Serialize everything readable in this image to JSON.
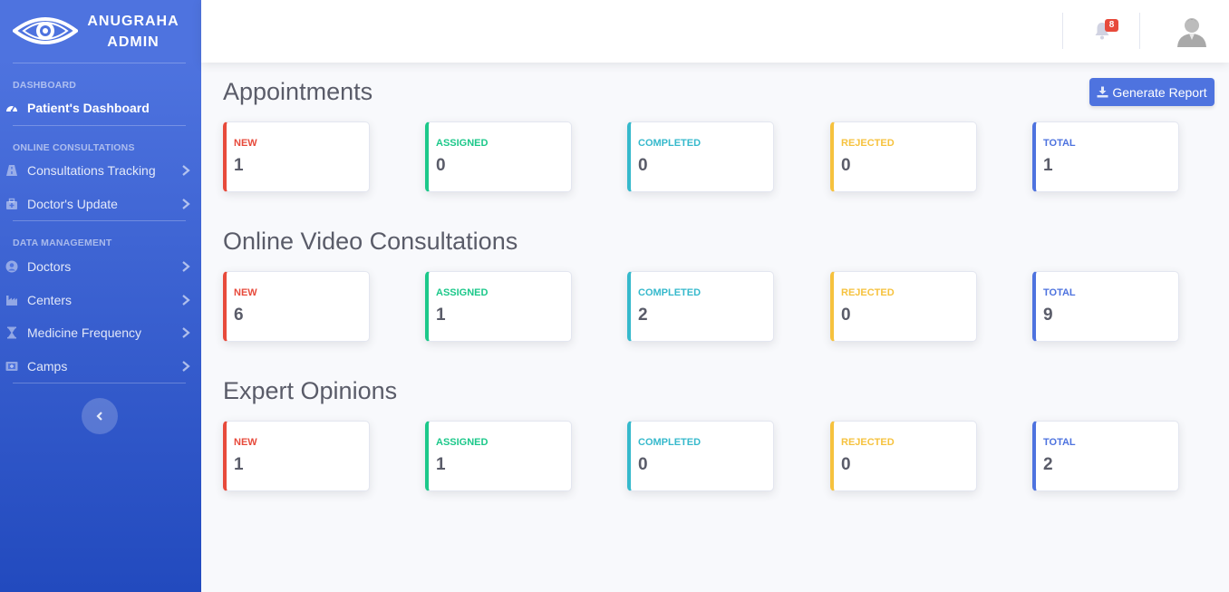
{
  "brand": {
    "line1": "ANUGRAHA",
    "line2": "ADMIN"
  },
  "sidebar": {
    "dashboard_heading": "DASHBOARD",
    "dashboard_item": "Patient's Dashboard",
    "online_heading": "ONLINE CONSULTATIONS",
    "online_items": [
      {
        "label": "Consultations Tracking",
        "icon": "road-icon"
      },
      {
        "label": "Doctor's Update",
        "icon": "briefcase-medical-icon"
      }
    ],
    "data_heading": "DATA MANAGEMENT",
    "data_items": [
      {
        "label": "Doctors",
        "icon": "user-circle-icon"
      },
      {
        "label": "Centers",
        "icon": "industry-icon"
      },
      {
        "label": "Medicine Frequency",
        "icon": "hourglass-icon"
      },
      {
        "label": "Camps",
        "icon": "clinic-icon"
      }
    ]
  },
  "topbar": {
    "notification_count": "8"
  },
  "actions": {
    "generate_report": "Generate Report"
  },
  "colors": {
    "new": "#e74a3b",
    "assigned": "#1cc88a",
    "completed": "#36b9cc",
    "rejected": "#f6c23e",
    "total": "#4e73df"
  },
  "sections": [
    {
      "title": "Appointments",
      "cards": [
        {
          "label": "NEW",
          "value": "1"
        },
        {
          "label": "ASSIGNED",
          "value": "0"
        },
        {
          "label": "COMPLETED",
          "value": "0"
        },
        {
          "label": "REJECTED",
          "value": "0"
        },
        {
          "label": "TOTAL",
          "value": "1"
        }
      ]
    },
    {
      "title": "Online Video Consultations",
      "cards": [
        {
          "label": "NEW",
          "value": "6"
        },
        {
          "label": "ASSIGNED",
          "value": "1"
        },
        {
          "label": "COMPLETED",
          "value": "2"
        },
        {
          "label": "REJECTED",
          "value": "0"
        },
        {
          "label": "TOTAL",
          "value": "9"
        }
      ]
    },
    {
      "title": "Expert Opinions",
      "cards": [
        {
          "label": "NEW",
          "value": "1"
        },
        {
          "label": "ASSIGNED",
          "value": "1"
        },
        {
          "label": "COMPLETED",
          "value": "0"
        },
        {
          "label": "REJECTED",
          "value": "0"
        },
        {
          "label": "TOTAL",
          "value": "2"
        }
      ]
    }
  ]
}
